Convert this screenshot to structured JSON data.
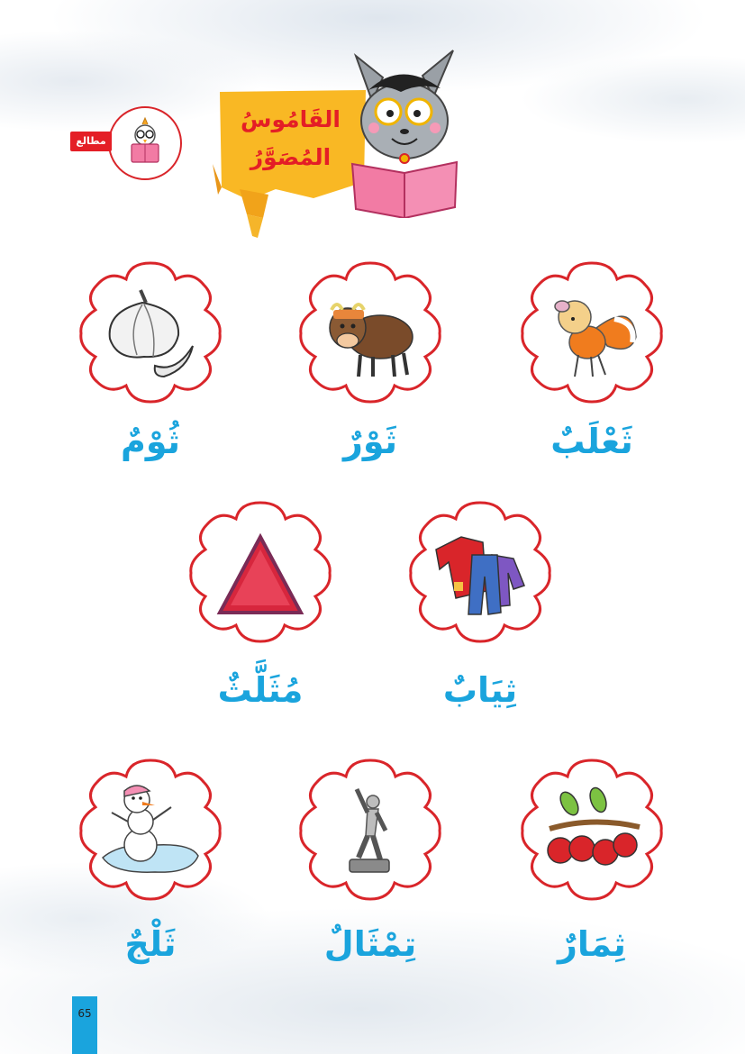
{
  "header": {
    "badge_label": "مطالع",
    "title_line1": "القَامُوسُ",
    "title_line2": "المُصَوَّرُ"
  },
  "cards": [
    {
      "word": "ثَعْلَبٌ",
      "icon": "fox-icon"
    },
    {
      "word": "ثَوْرٌ",
      "icon": "bull-icon"
    },
    {
      "word": "ثُوْمٌ",
      "icon": "garlic-icon"
    },
    {
      "word": "ثِيَابٌ",
      "icon": "clothes-icon"
    },
    {
      "word": "مُثَلَّثٌ",
      "icon": "triangle-icon"
    },
    {
      "word": "ثِمَارٌ",
      "icon": "cherries-icon"
    },
    {
      "word": "تِمْثَالٌ",
      "icon": "statue-icon"
    },
    {
      "word": "ثَلْجٌ",
      "icon": "snowman-icon"
    }
  ],
  "footer": {
    "page_number": "65"
  },
  "colors": {
    "accent_red": "#d9252a",
    "word_blue": "#1aa4dd",
    "banner_yellow": "#f9b824"
  }
}
